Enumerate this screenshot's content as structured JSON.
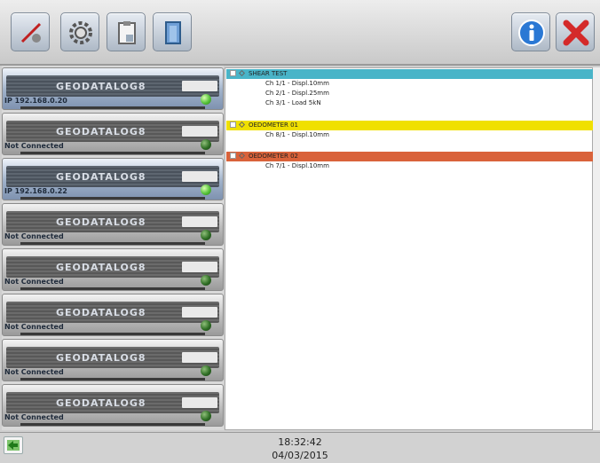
{
  "toolbar": {
    "buttons": [
      {
        "name": "probe-icon"
      },
      {
        "name": "gear-icon"
      },
      {
        "name": "clipboard-icon"
      },
      {
        "name": "door-icon"
      },
      {
        "name": "info-icon"
      },
      {
        "name": "close-icon"
      }
    ]
  },
  "devices": [
    {
      "brand": "GEODATALOG8",
      "address": "IP 192.168.0.20",
      "state": "connected"
    },
    {
      "brand": "GEODATALOG8",
      "address": "Not Connected",
      "state": "offline"
    },
    {
      "brand": "GEODATALOG8",
      "address": "IP 192.168.0.22",
      "state": "connected"
    },
    {
      "brand": "GEODATALOG8",
      "address": "Not Connected",
      "state": "offline"
    },
    {
      "brand": "GEODATALOG8",
      "address": "Not Connected",
      "state": "offline"
    },
    {
      "brand": "GEODATALOG8",
      "address": "Not Connected",
      "state": "offline"
    },
    {
      "brand": "GEODATALOG8",
      "address": "Not Connected",
      "state": "offline"
    },
    {
      "brand": "GEODATALOG8",
      "address": "Not Connected",
      "state": "offline"
    }
  ],
  "tree": {
    "groups": [
      {
        "title": "SHEAR TEST",
        "color": "#49b4c8",
        "channels": [
          "Ch 1/1 - Displ.10mm",
          "Ch 2/1 - Displ.25mm",
          "Ch 3/1 - Load 5kN"
        ]
      },
      {
        "title": "OEDOMETER 01",
        "color": "#f0e000",
        "channels": [
          "Ch 8/1 - Displ.10mm"
        ]
      },
      {
        "title": "OEDOMETER 02",
        "color": "#d9623a",
        "channels": [
          "Ch 7/1 - Displ.10mm"
        ]
      }
    ]
  },
  "status": {
    "time": "18:32:42",
    "date": "04/03/2015"
  }
}
